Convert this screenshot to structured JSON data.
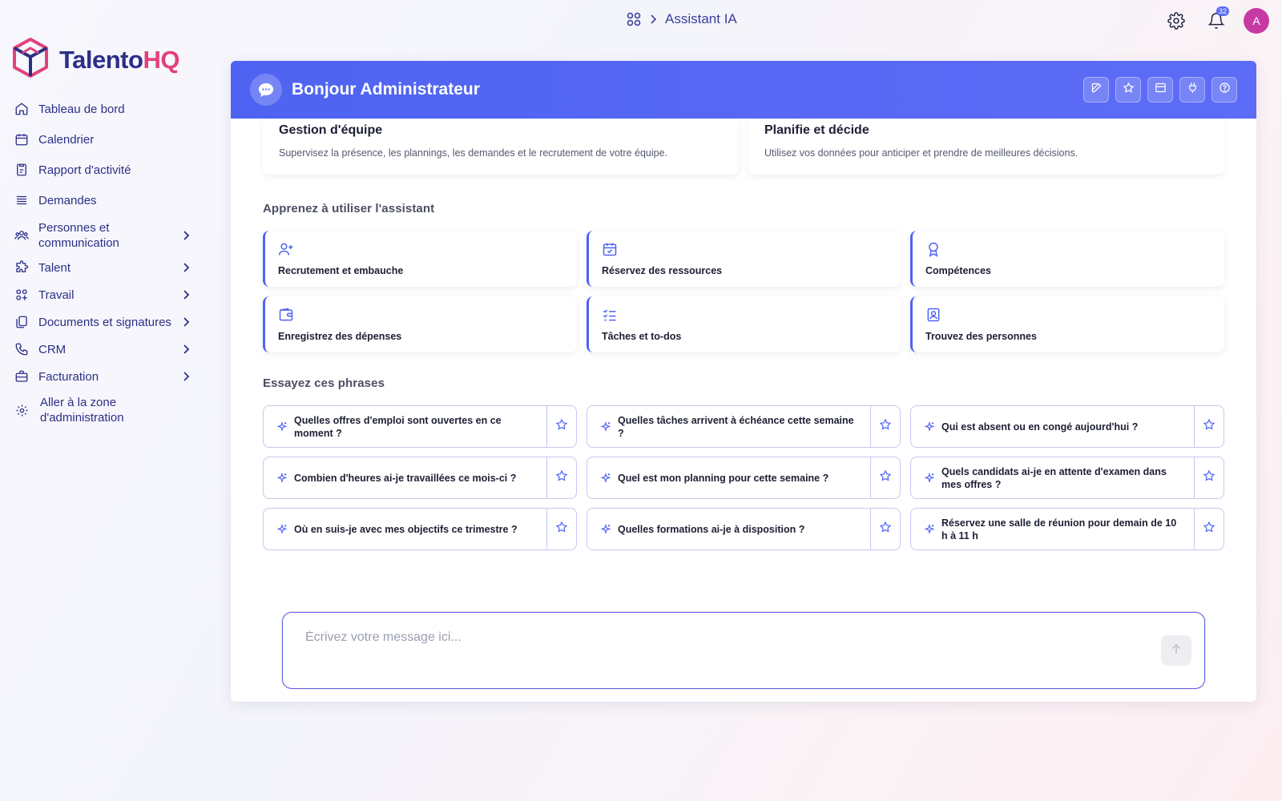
{
  "breadcrumb": {
    "current": "Assistant IA"
  },
  "topbar": {
    "notification_count": "32",
    "avatar_initial": "A"
  },
  "logo": {
    "part1": "Talento",
    "part2": "HQ"
  },
  "sidebar": {
    "items": [
      {
        "label": "Tableau de bord",
        "icon": "home-icon"
      },
      {
        "label": "Calendrier",
        "icon": "calendar-icon"
      },
      {
        "label": "Rapport d'activité",
        "icon": "report-icon"
      },
      {
        "label": "Demandes",
        "icon": "stack-icon"
      },
      {
        "label": "Personnes et communication",
        "icon": "people-icon"
      },
      {
        "label": "Talent",
        "icon": "puzzle-icon"
      },
      {
        "label": "Travail",
        "icon": "grid-icon"
      },
      {
        "label": "Documents et signatures",
        "icon": "documents-icon"
      },
      {
        "label": "CRM",
        "icon": "phone-icon"
      },
      {
        "label": "Facturation",
        "icon": "briefcase-icon"
      },
      {
        "label": "Aller à la zone d'administration",
        "icon": "gear-icon"
      }
    ]
  },
  "panel": {
    "title": "Bonjour Administrateur",
    "features": [
      {
        "title": "Gestion d'équipe",
        "desc": "Supervisez la présence, les plannings, les demandes et le recrutement de votre équipe."
      },
      {
        "title": "Planifie et décide",
        "desc": "Utilisez vos données pour anticiper et prendre de meilleures décisions."
      }
    ],
    "learn_title": "Apprenez à utiliser l'assistant",
    "learn": [
      {
        "label": "Recrutement et embauche",
        "icon": "user-plus-icon"
      },
      {
        "label": "Réservez des ressources",
        "icon": "calendar-check-icon"
      },
      {
        "label": "Compétences",
        "icon": "award-icon"
      },
      {
        "label": "Enregistrez des dépenses",
        "icon": "wallet-icon"
      },
      {
        "label": "Tâches et to-dos",
        "icon": "checklist-icon"
      },
      {
        "label": "Trouvez des personnes",
        "icon": "contact-icon"
      }
    ],
    "phrases_title": "Essayez ces phrases",
    "phrases": [
      "Quelles offres d'emploi sont ouvertes en ce moment ?",
      "Quelles tâches arrivent à échéance cette semaine ?",
      "Qui est absent ou en congé aujourd'hui ?",
      "Combien d'heures ai-je travaillées ce mois-ci ?",
      "Quel est mon planning pour cette semaine ?",
      "Quels candidats ai-je en attente d'examen dans mes offres ?",
      "Où en suis-je avec mes objectifs ce trimestre ?",
      "Quelles formations ai-je à disposition ?",
      "Réservez une salle de réunion pour demain de 10 h à 11 h"
    ],
    "input_placeholder": "Écrivez votre message ici..."
  }
}
